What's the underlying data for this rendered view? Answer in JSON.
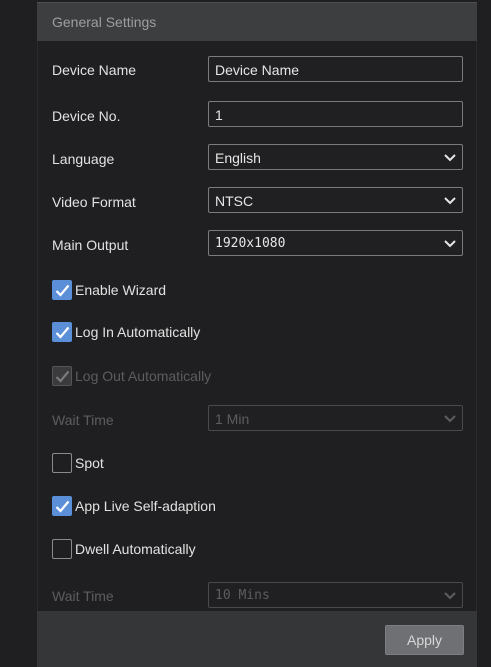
{
  "header": {
    "title": "General Settings"
  },
  "fields": {
    "device_name": {
      "label": "Device Name",
      "value": "Device Name"
    },
    "device_no": {
      "label": "Device No.",
      "value": "1"
    },
    "language": {
      "label": "Language",
      "value": "English"
    },
    "video_format": {
      "label": "Video Format",
      "value": "NTSC"
    },
    "main_output": {
      "label": "Main Output",
      "value": "1920x1080"
    },
    "wait_time_logout": {
      "label": "Wait Time",
      "value": "1 Min"
    },
    "wait_time_dwell": {
      "label": "Wait Time",
      "value": "10 Mins"
    }
  },
  "checkboxes": {
    "enable_wizard": {
      "label": "Enable Wizard",
      "checked": true,
      "enabled": true
    },
    "log_in_auto": {
      "label": "Log In Automatically",
      "checked": true,
      "enabled": true
    },
    "log_out_auto": {
      "label": "Log Out Automatically",
      "checked": true,
      "enabled": false
    },
    "spot": {
      "label": "Spot",
      "checked": false,
      "enabled": true
    },
    "app_live": {
      "label": "App Live Self-adaption",
      "checked": true,
      "enabled": true
    },
    "dwell_auto": {
      "label": "Dwell Automatically",
      "checked": false,
      "enabled": true
    }
  },
  "footer": {
    "apply_label": "Apply"
  },
  "colors": {
    "accent": "#5b8fd8",
    "background": "#1f1f21",
    "header": "#3c3e40"
  },
  "icons": {
    "dropdown": "chevron-down-icon",
    "check": "checkmark-icon"
  }
}
